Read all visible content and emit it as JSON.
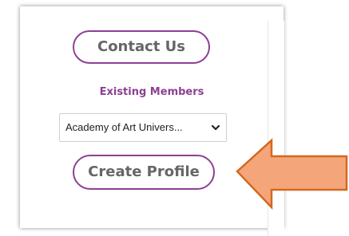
{
  "panel": {
    "contact_button_label": "Contact Us",
    "existing_members_heading": "Existing Members",
    "school_select": {
      "selected_value": "Academy of Art Univers..."
    },
    "create_profile_label": "Create Profile"
  },
  "icons": {
    "select_chevron": "chevron-down-icon",
    "pointer_arrow": "left-arrow-icon"
  },
  "colors": {
    "brand_purple": "#8e3f94",
    "button_text": "#666666",
    "arrow_fill": "#f4a67a",
    "arrow_stroke": "#d2691e"
  }
}
